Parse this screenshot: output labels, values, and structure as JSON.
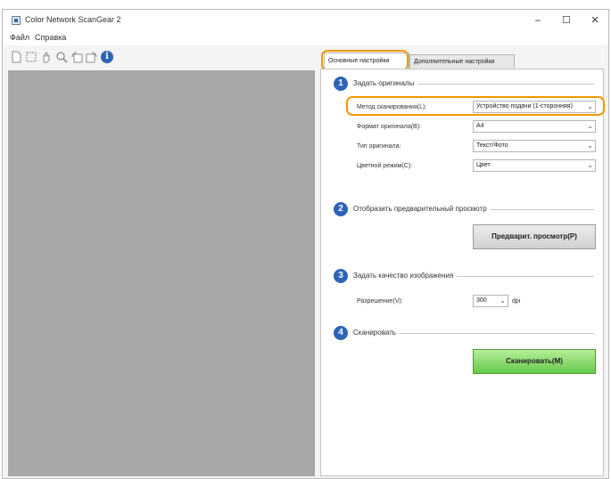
{
  "window": {
    "title": "Color Network ScanGear 2",
    "controls": {
      "minimize": "−",
      "maximize": "☐",
      "close": "✕"
    }
  },
  "menu": {
    "items": [
      "Файл",
      "Справка"
    ]
  },
  "toolbar": {
    "icons": [
      "new-page-icon",
      "select-frame-icon",
      "hand-icon",
      "zoom-icon",
      "rotate-left-icon",
      "rotate-right-icon",
      "info-icon"
    ],
    "info_glyph": "i"
  },
  "tabs": [
    "Основные настройки",
    "Дополнительные настройки"
  ],
  "sections": [
    {
      "number": "1",
      "title": "Задать оригиналы"
    },
    {
      "number": "2",
      "title": "Отобразить предварительный просмотр"
    },
    {
      "number": "3",
      "title": "Задать качество изображения"
    },
    {
      "number": "4",
      "title": "Сканировать"
    }
  ],
  "originals": {
    "scan_method": {
      "label": "Метод сканирования(L):",
      "value": "Устройство подачи (1-сторонняя)"
    },
    "paper_size": {
      "label": "Формат оригинала(B):",
      "value": "A4"
    },
    "original_type": {
      "label": "Тип оригинала:",
      "value": "Текст/Фото"
    },
    "color_mode": {
      "label": "Цветной режим(C):",
      "value": "Цвет"
    }
  },
  "preview": {
    "button": "Предварит. просмотр(P)"
  },
  "quality": {
    "resolution": {
      "label": "Разрешение(V):",
      "value": "300",
      "unit": "dpi"
    }
  },
  "scan": {
    "button": "Сканировать(M)"
  },
  "colors": {
    "accent": "#2e63b8",
    "highlight": "#f39800",
    "scan_button": "#7fd45c",
    "preview_area": "#a8a8a8"
  }
}
